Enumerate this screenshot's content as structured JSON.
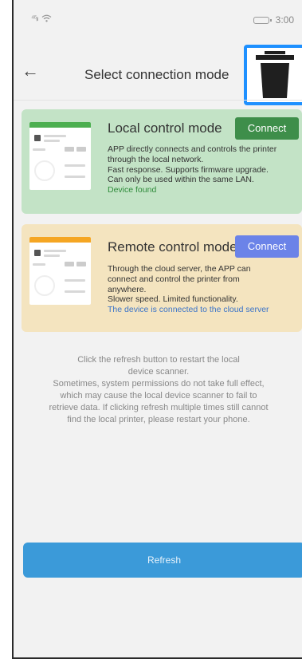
{
  "status_bar": {
    "signal": "⁴⁶ᵢₗₗ",
    "wifi_icon": "wifi-icon",
    "time": "3:00"
  },
  "header": {
    "back_icon": "←",
    "title": "Select connection mode",
    "trash_icon": "trash-icon"
  },
  "local_mode": {
    "title": "Local control mode",
    "connect_label": "Connect",
    "description_lines": [
      "APP directly connects and controls the printer",
      "through the local network.",
      "Fast response. Supports firmware upgrade.",
      "Can only be used within the same LAN."
    ],
    "status": "Device found",
    "accent_color": "#3e8e4a",
    "card_color": "#c3e3c6"
  },
  "remote_mode": {
    "title": "Remote control mode",
    "connect_label": "Connect",
    "description_lines": [
      "Through the cloud server, the APP can",
      "connect and control the printer from",
      "anywhere.",
      "Slower speed. Limited functionality."
    ],
    "status": "The device is connected to the cloud server",
    "accent_color": "#6b83e8",
    "card_color": "#f4e4bf"
  },
  "hint_lines": [
    "Click the refresh button to restart the local",
    "device scanner.",
    "Sometimes, system permissions do not take full effect,",
    "which may cause the local device scanner to fail to",
    "retrieve data. If clicking refresh multiple times still cannot",
    "find the local printer, please restart your phone."
  ],
  "refresh_label": "Refresh",
  "colors": {
    "accent_blue": "#3b9ad9",
    "highlight_border": "#1e90ff"
  }
}
